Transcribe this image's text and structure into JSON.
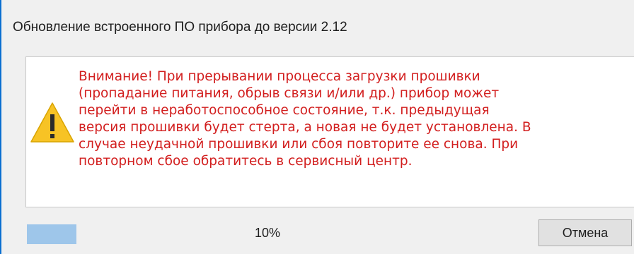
{
  "dialog": {
    "title": "Обновление встроенного ПО прибора до версии 2.12",
    "warning": {
      "icon": "warning-triangle-icon",
      "text": "Внимание! При прерывании процесса загрузки прошивки\n(пропадание питания, обрыв связи и/или др.) прибор может\nперейти в неработоспособное состояние, т.к. предыдущая\nверсия прошивки будет стерта, а новая не будет установлена. В\nслучае неудачной прошивки или сбоя повторите ее снова. При\nповторном сбое обратитесь в сервисный центр."
    },
    "progress": {
      "value": 0.1,
      "label": "10%"
    },
    "cancel_label": "Отмена"
  },
  "colors": {
    "accent": "#0b6fd1",
    "warning_text": "#d21e1e",
    "progress_fill": "#9ec6ea",
    "icon_yellow": "#f7c325"
  }
}
